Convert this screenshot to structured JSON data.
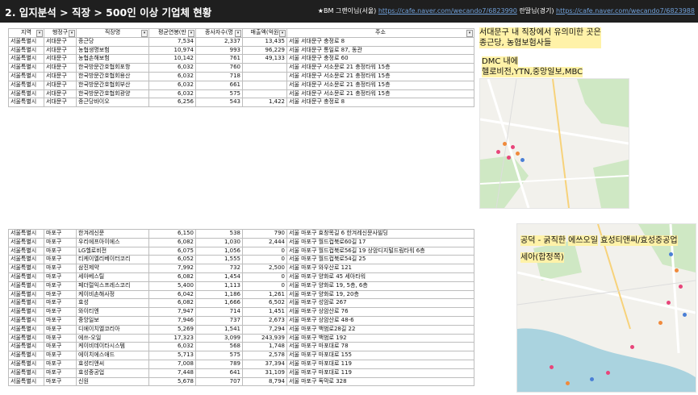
{
  "header": {
    "title": "2. 입지분석 > 직장 > 500인 이상 기업체 현황",
    "credit_prefix": "★BM 그랜이님(서울)",
    "link1": "https://cafe.naver.com/wecando7/6823990",
    "credit_mid": "란딸님(경기)",
    "link2": "https://cafe.naver.com/wecando7/6823988"
  },
  "table_headers": [
    "지역",
    "행정구",
    "직장명",
    "평균연봉(만",
    "종사자수(명",
    "매출액(억원",
    "주소"
  ],
  "table1_rows": [
    [
      "서울특별시",
      "서대문구",
      "종근당",
      "7,534",
      "2,337",
      "13,435",
      "서울 서대문구 충정로 8"
    ],
    [
      "서울특별시",
      "서대문구",
      "농협생명보험",
      "10,974",
      "993",
      "96,229",
      "서울 서대문구 통일로 87, 동관"
    ],
    [
      "서울특별시",
      "서대문구",
      "농협손해보험",
      "10,142",
      "761",
      "49,133",
      "서울 서대문구 충정로 60"
    ],
    [
      "서울특별시",
      "서대문구",
      "한국방문간호협회포항",
      "6,032",
      "760",
      "",
      "서울 서대문구 서소문로 21 충정타워 15층"
    ],
    [
      "서울특별시",
      "서대문구",
      "한국방문간호협회용산",
      "6,032",
      "718",
      "",
      "서울 서대문구 서소문로 21 충정타워 15층"
    ],
    [
      "서울특별시",
      "서대문구",
      "한국방문간호협회부산",
      "6,032",
      "661",
      "",
      "서울 서대문구 서소문로 21 충정타워 15층"
    ],
    [
      "서울특별시",
      "서대문구",
      "한국방문간호협회광양",
      "6,032",
      "575",
      "",
      "서울 서대문구 서소문로 21 충정타워 15층"
    ],
    [
      "서울특별시",
      "서대문구",
      "종근당바이오",
      "6,256",
      "543",
      "1,422",
      "서울 서대문구 충정로 8"
    ]
  ],
  "table2_rows": [
    [
      "서울특별시",
      "마포구",
      "한겨레신문",
      "6,150",
      "538",
      "790",
      "서울 마포구 효창목길 6 한겨레신문사빌딩"
    ],
    [
      "서울특별시",
      "마포구",
      "우리에프아이에스",
      "6,082",
      "1,030",
      "2,444",
      "서울 마포구 월드컵북로60길 17"
    ],
    [
      "서울특별시",
      "마포구",
      "LG헬로비전",
      "6,075",
      "1,056",
      "0",
      "서울 마포구 월드컵북로56길 19 상암디지털드림타워 6층"
    ],
    [
      "서울특별시",
      "마포구",
      "티케이엘리베이터코리",
      "6,052",
      "1,555",
      "0",
      "서울 마포구 월드컵북로54길 25"
    ],
    [
      "서울특별시",
      "마포구",
      "삼진제약",
      "7,992",
      "732",
      "2,500",
      "서울 마포구 와우산로 121"
    ],
    [
      "서울특별시",
      "마포구",
      "세아베스틸",
      "6,082",
      "1,454",
      "0",
      "서울 마포구 양화로 45 세아타워"
    ],
    [
      "서울특별시",
      "마포구",
      "페더럴익스프레스코리",
      "5,400",
      "1,113",
      "0",
      "서울 마포구 양화로 19, 5층, 6층"
    ],
    [
      "서울특별시",
      "마포구",
      "케이비손해사정",
      "6,042",
      "1,186",
      "1,261",
      "서울 마포구 양화로 19, 20층"
    ],
    [
      "서울특별시",
      "마포구",
      "효성",
      "6,082",
      "1,666",
      "6,502",
      "서울 마포구 성암로 267"
    ],
    [
      "서울특별시",
      "마포구",
      "와이티엔",
      "7,947",
      "714",
      "1,451",
      "서울 마포구 상암산로 76"
    ],
    [
      "서울특별시",
      "마포구",
      "중앙일보",
      "7,946",
      "737",
      "2,673",
      "서울 마포구 상암산로 48-6"
    ],
    [
      "서울특별시",
      "마포구",
      "디에이치엘코리아",
      "5,269",
      "1,541",
      "7,294",
      "서울 마포구 백범로28길 22"
    ],
    [
      "서울특별시",
      "마포구",
      "에쓰-오일",
      "17,323",
      "3,099",
      "243,939",
      "서울 마포구 백범로 192"
    ],
    [
      "서울특별시",
      "마포구",
      "케이비데이타시스템",
      "6,032",
      "568",
      "1,748",
      "서울 마포구 마포대로 78"
    ],
    [
      "서울특별시",
      "마포구",
      "에이치에스애드",
      "5,713",
      "575",
      "2,578",
      "서울 마포구 마포대로 155"
    ],
    [
      "서울특별시",
      "마포구",
      "효성티앤씨",
      "7,008",
      "789",
      "37,394",
      "서울 마포구 마포대로 119"
    ],
    [
      "서울특별시",
      "마포구",
      "효성중공업",
      "7,448",
      "641",
      "31,109",
      "서울 마포구 마포대로 119"
    ],
    [
      "서울특별시",
      "마포구",
      "신원",
      "5,678",
      "707",
      "8,794",
      "서울 마포구 독막로 328"
    ]
  ],
  "note1": {
    "line1": "서대문구 내 직장에서 유의미한 곳은",
    "line2": "종근당, 농협보험사들"
  },
  "note2": {
    "line1": "DMC 내에",
    "line2": "헬로비전,YTN,중앙일보,MBC"
  },
  "note3": {
    "line1": "공덕 - 굵직한",
    "line2": "에쓰오일",
    "line3": "효성티앤씨/효성중공업",
    "line4": "세아(합정쪽)"
  },
  "colors": {
    "header_bg": "#1f1f1f",
    "highlight": "#fff2a8",
    "map_land": "#f2f1ec",
    "map_green": "#cfe8c4",
    "map_water": "#aad3df"
  }
}
